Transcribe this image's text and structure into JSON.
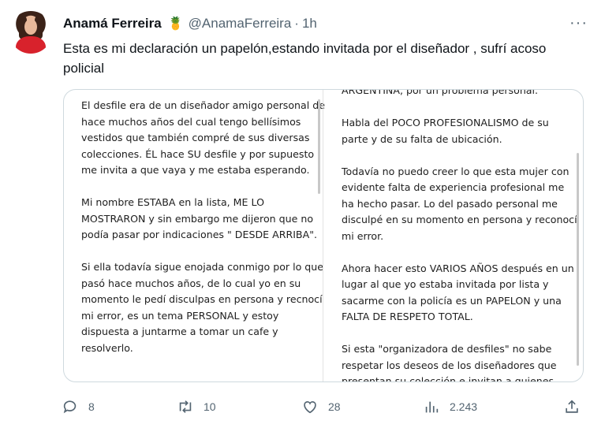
{
  "tweet": {
    "author_name": "Anamá Ferreira",
    "emoji": "🍍",
    "handle": "@AnamaFerreira",
    "separator": "·",
    "time": "1h",
    "more": "···",
    "text": "Esta es mi declaración un papelón,estando invitada por el diseñador , sufrí acoso policial"
  },
  "media": {
    "left_paragraphs": [
      "El desfile era de un diseñador amigo personal de hace muchos años del cual tengo bellísimos vestidos que también compré de sus diversas colecciones. ÉL hace SU desfile y por supuesto me invita a que vaya y me estaba esperando.",
      "Mi nombre ESTABA en la lista, ME LO MOSTRARON y sin embargo me dijeron que no podía pasar por indicaciones \" DESDE ARRIBA\".",
      "Si ella todavía sigue enojada conmigo por lo que pasó hace muchos años, de lo cual yo en su momento le pedí disculpas en persona y recnocí mi error, es un tema PERSONAL y estoy dispuesta a juntarme a tomar un cafe y resolverlo."
    ],
    "right_paragraphs": [
      "ARGENTINA, por un problema personal.",
      "Habla del POCO PROFESIONALISMO de su parte y de su falta de ubicación.",
      "Todavía no puedo creer lo que esta mujer con evidente falta de experiencia profesional me ha hecho pasar. Lo del pasado personal me disculpé en su momento en persona y reconocí mi error.",
      "Ahora hacer esto VARIOS AÑOS después en un lugar al que yo estaba invitada por lista y sacarme con la policía es un PAPELON y una FALTA DE RESPETO TOTAL.",
      "Si esta \"organizadora de desfiles\" no sabe respetar los deseos de los diseñadores que presentan su colección e invitan a quienes"
    ]
  },
  "actions": {
    "replies": "8",
    "retweets": "10",
    "likes": "28",
    "views": "2.243"
  },
  "icons": [
    "reply-icon",
    "retweet-icon",
    "like-icon",
    "views-icon",
    "share-icon"
  ]
}
